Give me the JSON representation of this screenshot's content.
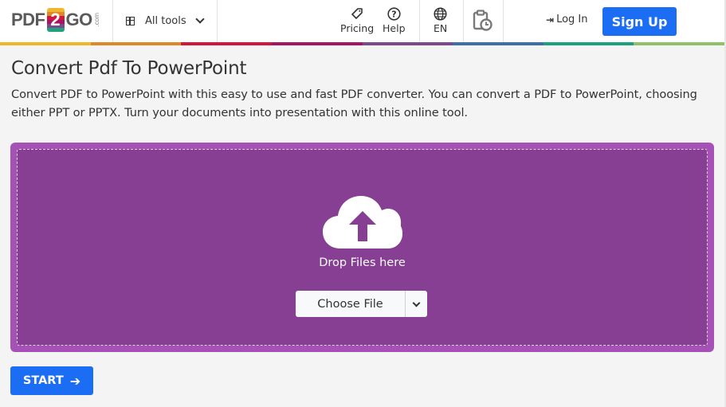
{
  "header": {
    "logo": {
      "left": "PDF",
      "badge": "2",
      "right": "GO",
      "suffix": ".com"
    },
    "all_tools_label": "All tools",
    "nav": [
      {
        "label": "Pricing",
        "icon": "tag-icon"
      },
      {
        "label": "Help",
        "icon": "question-circle-icon"
      },
      {
        "label": "EN",
        "icon": "globe-icon"
      }
    ],
    "history_icon": "clipboard-clock-icon",
    "login_label": "Log In",
    "signup_label": "Sign Up",
    "stripe_colors": [
      "#f0b62c",
      "#e0872a",
      "#d4163c",
      "#a51563",
      "#7b4a8e",
      "#3f6fa8",
      "#1da07e",
      "#8fc06a"
    ]
  },
  "main": {
    "title": "Convert Pdf To PowerPoint",
    "description": "Convert PDF to PowerPoint with this easy to use and fast PDF converter. You can convert a PDF to PowerPoint, choosing either PPT or PPTX. Turn your documents into presentation with this online tool.",
    "dropzone": {
      "drop_text": "Drop Files here",
      "choose_file_label": "Choose File"
    },
    "start_label": "START"
  },
  "colors": {
    "accent_blue": "#1b6ef3",
    "dropzone_outer": "#a651b5",
    "dropzone_inner": "#863f93"
  }
}
